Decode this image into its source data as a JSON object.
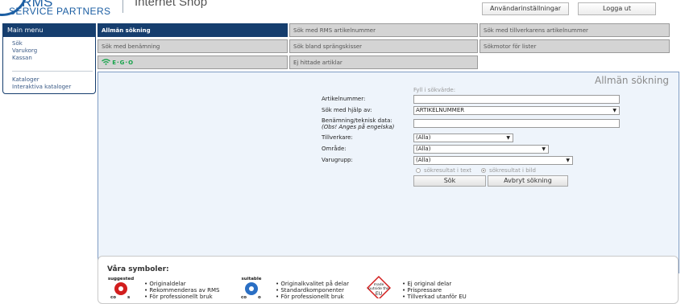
{
  "header": {
    "logo_text": "RMS",
    "logo_subtitle": "SERVICE PARTNERS",
    "shop_title": "Internet Shop",
    "settings_button": "Användarinställningar",
    "logout_button": "Logga ut"
  },
  "sidebar": {
    "title": "Main menu",
    "items": [
      "Sök",
      "Varukorg",
      "Kassan"
    ],
    "items2": [
      "Kataloger",
      "Interaktiva kataloger"
    ]
  },
  "tabs": {
    "row1": [
      "Allmän sökning",
      "Sök med RMS artikelnummer",
      "Sök med tillverkarens artikelnummer"
    ],
    "row2": [
      "Sök med benämning",
      "Sök bland sprängskisser",
      "Sökmotor för lister"
    ],
    "row3": [
      "Ej hittade artiklar"
    ],
    "ego_label": "E·G·O"
  },
  "search": {
    "title": "Allmän sökning",
    "hint": "Fyll i sökvärde:",
    "labels": {
      "article": "Artikelnummer:",
      "search_by": "Sök med hjälp av:",
      "description_1": "Benämning/teknisk data:",
      "description_2": "(Obs! Anges på engelska)",
      "manufacturer": "Tillverkare:",
      "area": "Område:",
      "group": "Varugrupp:"
    },
    "values": {
      "article": "",
      "search_by": "ARTIKELNUMMER",
      "description": "",
      "manufacturer": "(Alla)",
      "area": "(Alla)",
      "group": "(Alla)"
    },
    "radio_text": "sökresultat i text",
    "radio_image": "sökresultat i bild",
    "selected_result_mode": "image",
    "search_button": "Sök",
    "cancel_button": "Avbryt sökning"
  },
  "symbols": {
    "title": "Våra symboler:",
    "badge_words": [
      "suggested",
      "suitable",
      "made outside the EU"
    ],
    "col1": [
      "Originaldelar",
      "Rekommenderas av RMS",
      "För professionellt bruk"
    ],
    "col2": [
      "Originalkvalitet på delar",
      "Standardkomponenter",
      "För professionellt bruk"
    ],
    "col3": [
      "Ej original delar",
      "Prispressare",
      "Tillverkad utanför EU"
    ]
  },
  "colors": {
    "brand": "#1d5fa3",
    "nav": "#163e6e",
    "panel": "#eef4fb"
  }
}
